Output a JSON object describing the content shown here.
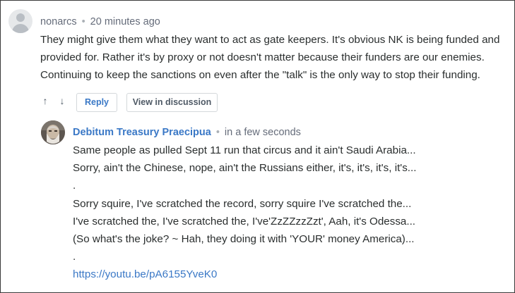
{
  "comment": {
    "author": "nonarcs",
    "separator": "•",
    "time": "20 minutes ago",
    "lines": [
      "They might give them what they want to act as gate keepers. It's obvious NK is being funded and",
      "provided for. Rather it's by proxy or not doesn't matter because their funders are our enemies.",
      "Continuing to keep the sanctions on even after the \"talk\" is the only way to stop their funding."
    ],
    "avatar_icon": "guest-avatar-icon"
  },
  "actions": {
    "upvote_glyph": "↑",
    "downvote_glyph": "↓",
    "reply_label": "Reply",
    "view_label": "View in discussion"
  },
  "reply": {
    "author": "Debitum Treasury Praecipua",
    "separator": "•",
    "time": "in a few seconds",
    "lines": [
      "Same people as pulled Sept 11 run that circus and it ain't Saudi Arabia...",
      "Sorry, ain't the Chinese, nope, ain't the Russians either, it's, it's, it's, it's...",
      ".",
      "Sorry squire, I've scratched the record, sorry squire I've scratched the...",
      "I've scratched the, I've scratched the, I've'ZzZZzzZzt', Aah, it's Odessa...",
      "(So what's the joke? ~ Hah, they doing it with 'YOUR' money America)...",
      "."
    ],
    "link": "https://youtu.be/pA6155YveK0",
    "avatar_icon": "user-portrait-avatar"
  },
  "colors": {
    "link_blue": "#3a78c6",
    "text": "#2a2e2e",
    "meta_gray": "#656c7a",
    "border": "#d4d8db"
  }
}
